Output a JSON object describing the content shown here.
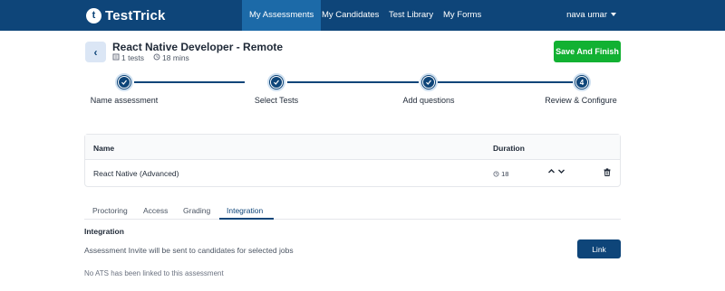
{
  "nav": {
    "logo_text": "TestTrick",
    "logo_letter": "t",
    "tabs": [
      {
        "label": "My Assessments"
      },
      {
        "label": "My Candidates"
      },
      {
        "label": "Test Library"
      },
      {
        "label": "My Forms"
      }
    ],
    "user_name": "nava umar"
  },
  "header": {
    "back_symbol": "‹",
    "title": "React Native Developer - Remote",
    "tests_count": "1 tests",
    "duration": "18 mins",
    "save_label": "Save And Finish"
  },
  "stepper": {
    "steps": [
      {
        "label": "Name assessment",
        "state": "done"
      },
      {
        "label": "Select Tests",
        "state": "done"
      },
      {
        "label": "Add questions",
        "state": "done"
      },
      {
        "label": "Review & Configure",
        "state": "current",
        "number": "4"
      }
    ]
  },
  "table": {
    "headers": {
      "name": "Name",
      "duration": "Duration"
    },
    "rows": [
      {
        "name": "React Native (Advanced)",
        "duration": "18"
      }
    ]
  },
  "tabs": [
    {
      "label": "Proctoring",
      "active": false
    },
    {
      "label": "Access",
      "active": false
    },
    {
      "label": "Grading",
      "active": false
    },
    {
      "label": "Integration",
      "active": true
    }
  ],
  "integration": {
    "title": "Integration",
    "description": "Assessment Invite will be sent to candidates for selected jobs",
    "link_label": "Link",
    "note": "No ATS has been linked to this assessment"
  },
  "colors": {
    "primary": "#0e4579",
    "active_tab": "#1c6aa8",
    "success": "#12b132"
  }
}
